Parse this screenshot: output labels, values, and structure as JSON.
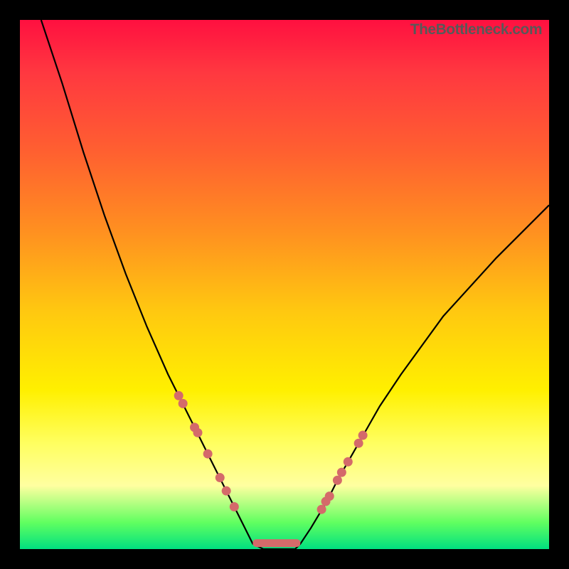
{
  "watermark": "TheBottleneck.com",
  "chart_data": {
    "type": "line",
    "title": "",
    "xlabel": "",
    "ylabel": "",
    "xlim": [
      0,
      100
    ],
    "ylim": [
      0,
      100
    ],
    "curve": {
      "description": "V-shaped bottleneck curve; y is bottleneck percentage (0 = no bottleneck, at bottom). Minimum is a flat segment near x 44-53 at y 0.",
      "x": [
        4,
        8,
        12,
        16,
        20,
        24,
        28,
        30,
        32,
        34,
        36,
        38,
        40,
        42,
        44,
        46,
        48,
        50,
        52,
        53,
        55,
        58,
        60,
        64,
        68,
        72,
        80,
        90,
        100
      ],
      "y": [
        100,
        88,
        75,
        63,
        52,
        42,
        33,
        29,
        25,
        21,
        17,
        13,
        9,
        5,
        1,
        0,
        0,
        0,
        0,
        1,
        4,
        9,
        13,
        20,
        27,
        33,
        44,
        55,
        65
      ]
    },
    "markers_left": {
      "x": [
        30.0,
        30.8,
        33.0,
        33.6,
        35.5,
        37.8,
        39.0,
        40.5
      ],
      "y": [
        29.0,
        27.5,
        23.0,
        22.0,
        18.0,
        13.5,
        11.0,
        8.0
      ]
    },
    "markers_right": {
      "x": [
        57.0,
        57.8,
        58.5,
        60.0,
        60.8,
        62.0,
        64.0,
        64.8
      ],
      "y": [
        7.5,
        9.0,
        10.0,
        13.0,
        14.5,
        16.5,
        20.0,
        21.5
      ]
    },
    "flat_segment_marker": {
      "x_start": 44,
      "x_end": 53,
      "y": 1.2,
      "color": "#d46a6a"
    },
    "marker_color": "#d46a6a",
    "curve_color": "#000000"
  }
}
